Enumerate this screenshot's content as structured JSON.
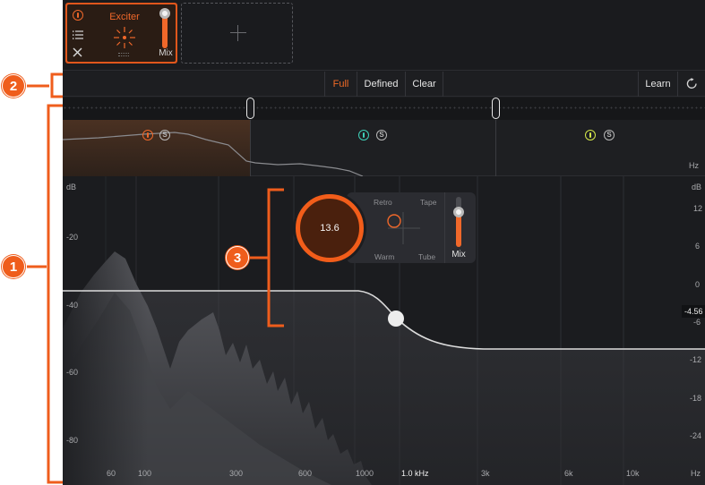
{
  "callouts": {
    "one": "1",
    "two": "2",
    "three": "3"
  },
  "modules": {
    "exciter": {
      "name": "Exciter",
      "mix_label": "Mix",
      "mix_level_pct": 92
    },
    "add_slot": {
      "icon": "plus-icon"
    }
  },
  "band_bar": {
    "modes": [
      "Full",
      "Defined",
      "Clear"
    ],
    "active_mode": "Full",
    "learn_label": "Learn",
    "reset_icon": "reset-icon"
  },
  "band_strip": {
    "unit": "Hz",
    "band_colors": [
      "#f0682a",
      "#3fd0b8",
      "#d5e84a"
    ]
  },
  "spectrum": {
    "left_scale_unit": "dB",
    "left_ticks": [
      "-20",
      "-40",
      "-60",
      "-80"
    ],
    "right_scale_unit": "dB",
    "right_ticks": [
      "12",
      "6",
      "0",
      "-6",
      "-12",
      "-18",
      "-24"
    ],
    "freq_ticks": [
      "60",
      "100",
      "300",
      "600",
      "1000",
      "1.0 kHz",
      "3k",
      "6k",
      "10k",
      "Hz"
    ],
    "gain_readout": "-4.56"
  },
  "exciter_panel": {
    "amount": "13.6",
    "mode_labels": {
      "retro": "Retro",
      "tape": "Tape",
      "warm": "Warm",
      "tube": "Tube"
    },
    "mix_label": "Mix",
    "mix_level_pct": 70
  },
  "colors": {
    "accent": "#ef5d1c",
    "background": "#1b1c1f"
  }
}
